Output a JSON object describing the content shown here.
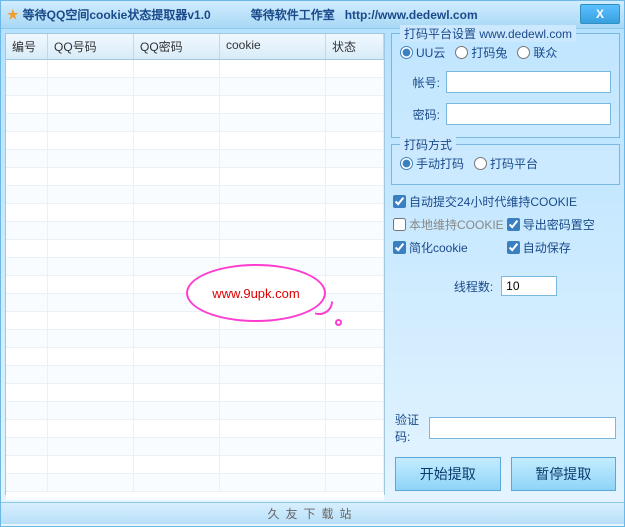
{
  "titlebar": {
    "title": "等待QQ空间cookie状态提取器v1.0",
    "studio": "等待软件工作室",
    "url": "http://www.dedewl.com",
    "close": "X"
  },
  "table": {
    "headers": [
      "编号",
      "QQ号码",
      "QQ密码",
      "cookie",
      "状态"
    ]
  },
  "platform_group": {
    "title": "打码平台设置 www.dedewl.com",
    "options": {
      "uu": "UU云",
      "tmtu": "打码兔",
      "lz": "联众"
    },
    "selected": "uu",
    "account_label": "帐号:",
    "password_label": "密码:",
    "account_value": "",
    "password_value": ""
  },
  "method_group": {
    "title": "打码方式",
    "manual": "手动打码",
    "auto": "打码平台",
    "selected": "manual"
  },
  "options": {
    "auto_submit": {
      "label": "自动提交24小时代维持COOKIE",
      "checked": true
    },
    "local_maintain": {
      "label": "本地维持COOKIE",
      "checked": false
    },
    "export_clear": {
      "label": "导出密码置空",
      "checked": true
    },
    "simplify": {
      "label": "简化cookie",
      "checked": true
    },
    "autosave": {
      "label": "自动保存",
      "checked": true
    }
  },
  "threads": {
    "label": "线程数:",
    "value": "10"
  },
  "captcha": {
    "label": "验证码:",
    "value": ""
  },
  "buttons": {
    "start": "开始提取",
    "pause": "暂停提取"
  },
  "footer": "久友下载站",
  "watermark": "www.9upk.com"
}
